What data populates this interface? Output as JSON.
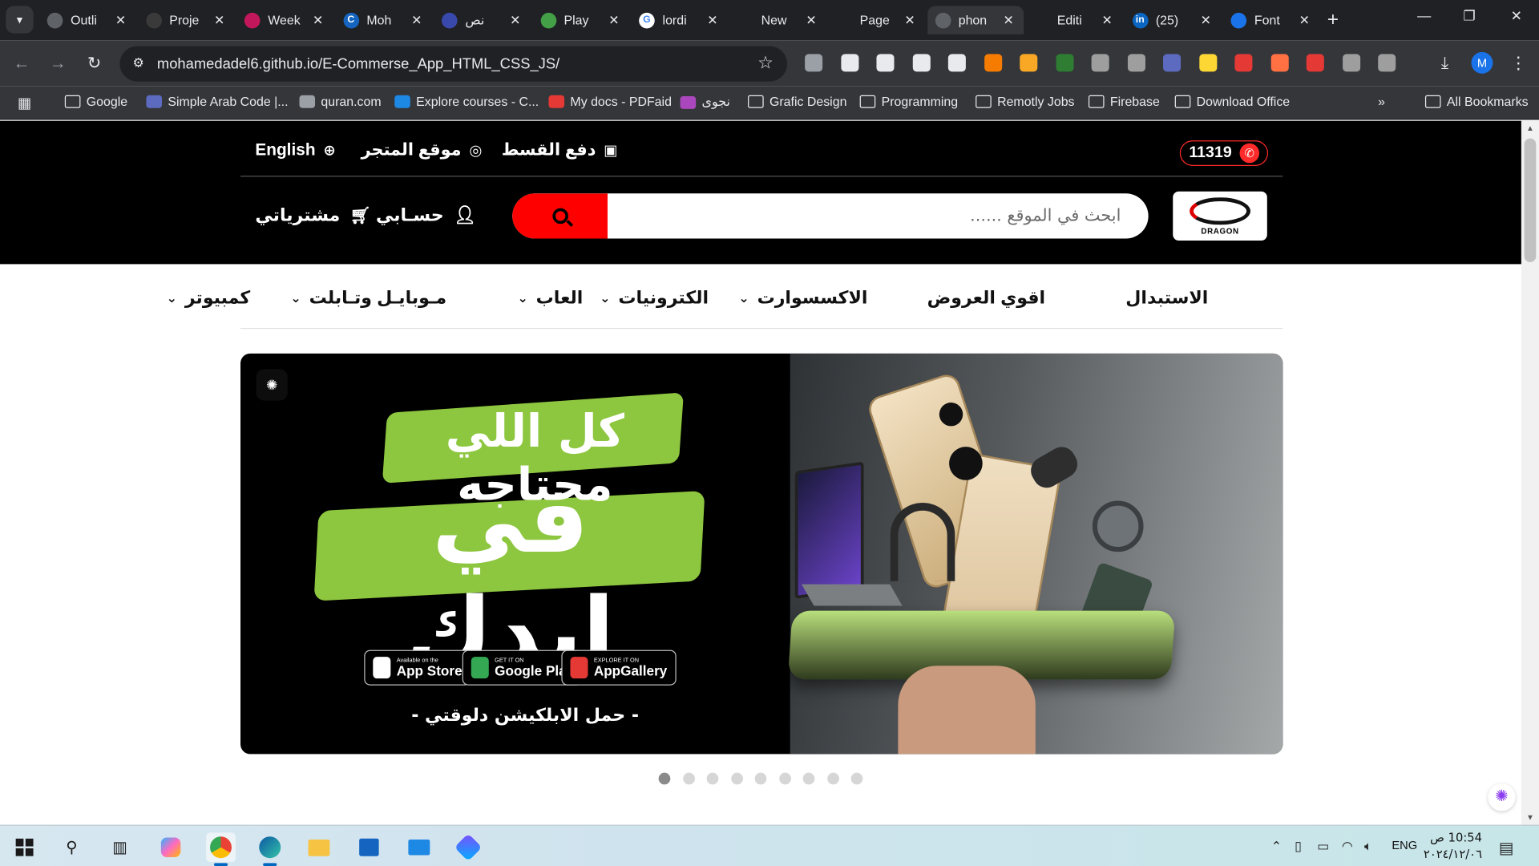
{
  "browser": {
    "tabs": [
      {
        "title": "Outli",
        "fav_color": "#5f6368",
        "fav": ""
      },
      {
        "title": "Proje",
        "fav_color": "#3a3a3a",
        "fav": ""
      },
      {
        "title": "Week",
        "fav_color": "#c2185b",
        "fav": ""
      },
      {
        "title": "Moh",
        "fav_color": "#1565c0",
        "fav": "C"
      },
      {
        "title": "نص",
        "fav_color": "#3949ab",
        "fav": ""
      },
      {
        "title": "Play",
        "fav_color": "#43a047",
        "fav": ""
      },
      {
        "title": "lordi",
        "fav_color": "#ffffff",
        "fav": "G"
      },
      {
        "title": "New",
        "fav_color": "#202124",
        "fav": ""
      },
      {
        "title": "Page",
        "fav_color": "#202124",
        "fav": ""
      },
      {
        "title": "phon",
        "fav_color": "#5f6368",
        "fav": ""
      },
      {
        "title": "Editi",
        "fav_color": "#202124",
        "fav": ""
      },
      {
        "title": "(25)",
        "fav_color": "#0a66c2",
        "fav": "in"
      },
      {
        "title": "Font",
        "fav_color": "#1a73e8",
        "fav": ""
      }
    ],
    "active_tab_index": 9,
    "url": "mohamedadel6.github.io/E-Commerse_App_HTML_CSS_JS/",
    "profile_initial": "M",
    "bookmarks": [
      "Google",
      "Simple Arab Code |...",
      "quran.com",
      "Explore courses - C...",
      "My docs - PDFaid",
      "نجوى",
      "Grafic Design",
      "Programming",
      "Remotly Jobs",
      "Firebase",
      "Download Office"
    ],
    "all_bookmarks": "All Bookmarks",
    "extension_colors": [
      "#9aa0a6",
      "#e8eaed",
      "#e8eaed",
      "#e8eaed",
      "#e8eaed",
      "#f57c00",
      "#f9a825",
      "#2e7d32",
      "#9e9e9e",
      "#9e9e9e",
      "#5c6bc0",
      "#fdd835",
      "#e53935",
      "#ff7043",
      "#e53935",
      "#9e9e9e",
      "#9e9e9e"
    ]
  },
  "site": {
    "hotline": "11319",
    "top_links": {
      "installments": "دفع القسط",
      "store_location": "موقع المتجر",
      "language": "English"
    },
    "logo_text": "DRAGON",
    "search_placeholder": "ابحث في الموقع ......",
    "account": "حسـابي",
    "purchases": "مشترياتي",
    "nav": [
      {
        "label": "كمبيوتر",
        "has_dropdown": true
      },
      {
        "label": "مـوبايـل وتـابلت",
        "has_dropdown": true
      },
      {
        "label": "العاب",
        "has_dropdown": true
      },
      {
        "label": "الكترونيات",
        "has_dropdown": true
      },
      {
        "label": "الاكسسوارت",
        "has_dropdown": true
      },
      {
        "label": "اقوي العروض",
        "has_dropdown": false
      },
      {
        "label": "الاستبدال",
        "has_dropdown": false
      }
    ],
    "banner": {
      "headline_top": "كل اللي محتاجه",
      "headline_big": "في ايدك",
      "stores": [
        {
          "small": "Available on the",
          "name": "App Store",
          "icon_color": "#ffffff"
        },
        {
          "small": "GET IT ON",
          "name": "Google Play",
          "icon_color": "#34a853"
        },
        {
          "small": "EXPLORE IT ON",
          "name": "AppGallery",
          "icon_color": "#e53935"
        }
      ],
      "cta": "- حمل الابلكيشن دلوقتي -",
      "accent_color": "#8dc63f"
    },
    "slider": {
      "count": 9,
      "active": 0
    },
    "colors": {
      "brand_red": "#ff0000",
      "header_bg": "#000000"
    }
  },
  "taskbar": {
    "time": "10:54 ص",
    "date": "٢٠٢٤/١٢/٠٦",
    "lang": "ENG"
  }
}
